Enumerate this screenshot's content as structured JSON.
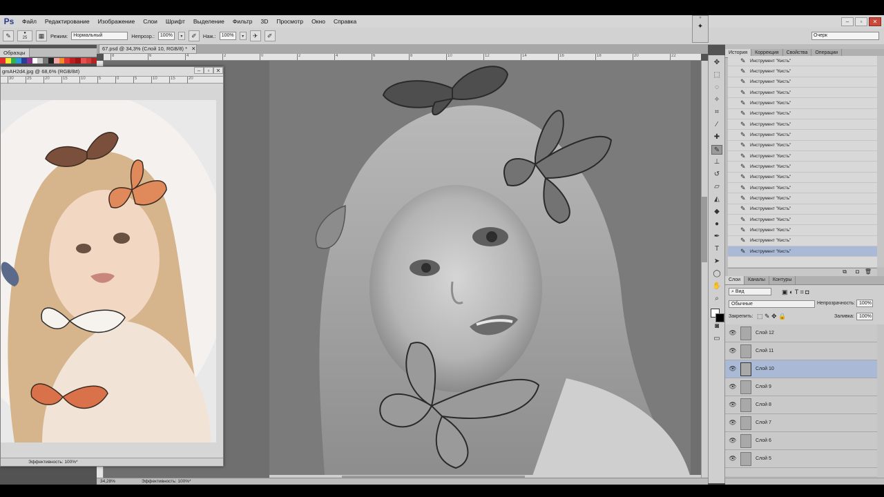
{
  "menu": {
    "logo": "Ps",
    "items": [
      "Файл",
      "Редактирование",
      "Изображение",
      "Слои",
      "Шрифт",
      "Выделение",
      "Фильтр",
      "3D",
      "Просмотр",
      "Окно",
      "Справка"
    ]
  },
  "options": {
    "brush_size": "25",
    "mode_label": "Режим:",
    "mode_value": "Нормальный",
    "opacity_label": "Непрозр.:",
    "opacity_value": "100%",
    "pressure_label": "Наж.:",
    "pressure_value": "100%",
    "workspace": "Очерк"
  },
  "swatches": {
    "tab": "Образцы",
    "colors": [
      "#e62d2d",
      "#f5e634",
      "#31b24a",
      "#2b9ad9",
      "#2a3d99",
      "#8e2e8f",
      "#ffffff",
      "#c8c8c8",
      "#777777",
      "#222222",
      "#f2a6a6",
      "#f08c2c",
      "#e23434",
      "#c21d1d",
      "#9d1414",
      "#e84f4f",
      "#d13d3d",
      "#b52424"
    ]
  },
  "document": {
    "tab_title": "67.psd @ 34,3% (Слой 10, RGB/8) *",
    "zoom": "34,28%",
    "efficiency": "Эффективность: 100%*",
    "ruler_ticks": [
      "8",
      "6",
      "4",
      "2",
      "0",
      "2",
      "4",
      "6",
      "8",
      "10",
      "12",
      "14",
      "16",
      "18",
      "20",
      "22"
    ]
  },
  "reference": {
    "title": "gmAH2d4.jpg @ 68,6% (RGB/8#)",
    "efficiency": "Эффективность: 100%*",
    "ruler_ticks": [
      "30",
      "25",
      "20",
      "15",
      "10",
      "5",
      "0",
      "5",
      "10",
      "15",
      "20"
    ]
  },
  "history": {
    "tabs": [
      "История",
      "Коррекция",
      "Свойства",
      "Операции"
    ],
    "item_label": "Инструмент \"Кисть\"",
    "count": 19,
    "selected_index": 18
  },
  "layers": {
    "tabs": [
      "Слои",
      "Каналы",
      "Контуры"
    ],
    "filter": "Вид",
    "blend": "Обычные",
    "opacity_label": "Непрозрачность:",
    "opacity": "100%",
    "lock_label": "Закрепить:",
    "fill_label": "Заливка:",
    "fill": "100%",
    "items": [
      "Слой 12",
      "Слой 11",
      "Слой 10",
      "Слой 9",
      "Слой 8",
      "Слой 7",
      "Слой 6",
      "Слой 5"
    ],
    "selected": "Слой 10"
  },
  "colors": {
    "accent_selected": "#aab9d6",
    "ui_bg": "#535353"
  }
}
